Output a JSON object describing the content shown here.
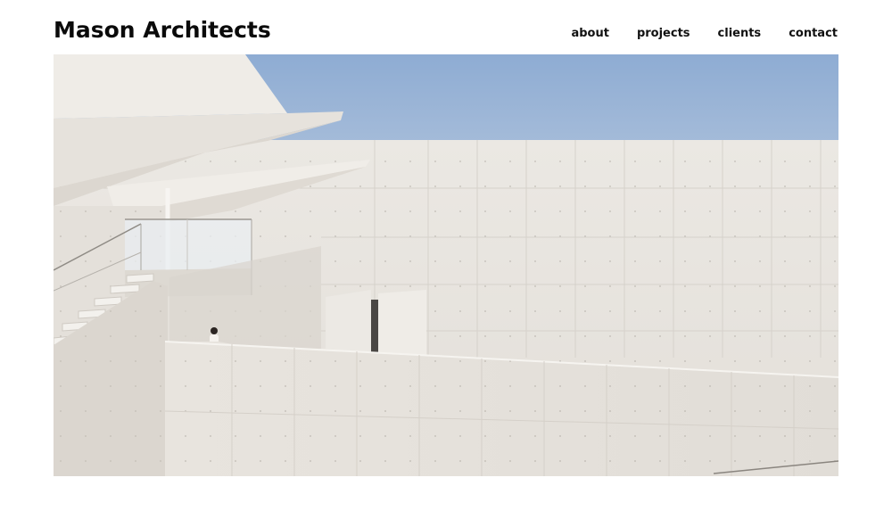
{
  "header": {
    "brand": "Mason Architects",
    "nav": [
      {
        "label": "about"
      },
      {
        "label": "projects"
      },
      {
        "label": "clients"
      },
      {
        "label": "contact"
      }
    ]
  },
  "hero": {
    "image_description_icon": "architecture-photo",
    "colors": {
      "sky": "#92afd4",
      "concrete_light": "#ece9e4",
      "concrete_mid": "#dedad4",
      "concrete_shadow": "#d2cdc6"
    }
  }
}
